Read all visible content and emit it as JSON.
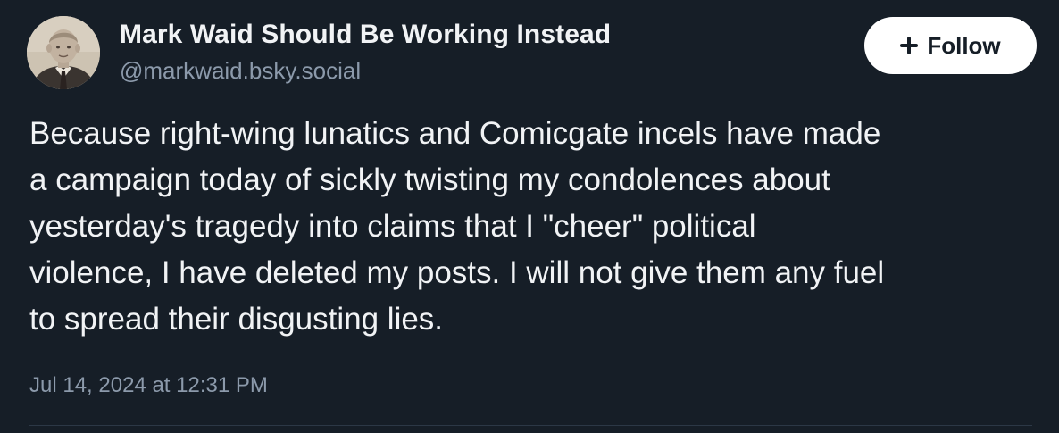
{
  "author": {
    "display_name": "Mark Waid Should Be Working Instead",
    "handle": "@markwaid.bsky.social"
  },
  "follow_button": {
    "label": "Follow",
    "icon": "plus-icon"
  },
  "post": {
    "text": "Because right-wing lunatics and Comicgate incels have made\na campaign today of sickly twisting my condolences about\nyesterday's tragedy into claims that I \"cheer\" political\nviolence, I have deleted my posts. I will not give them any fuel\nto spread their disgusting lies.",
    "timestamp": "Jul 14, 2024 at 12:31 PM"
  },
  "colors": {
    "background": "#161e27",
    "text_primary": "#f1f3f5",
    "text_secondary": "#8c9aab",
    "button_bg": "#ffffff",
    "divider": "#2c3846"
  }
}
